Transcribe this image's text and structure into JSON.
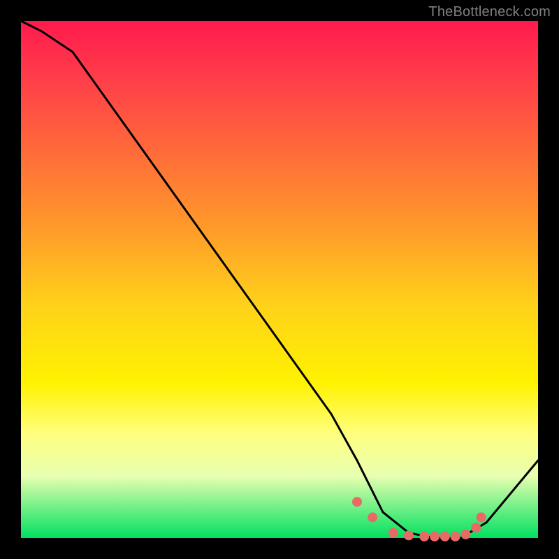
{
  "watermark": "TheBottleneck.com",
  "chart_data": {
    "type": "line",
    "title": "",
    "xlabel": "",
    "ylabel": "",
    "xlim": [
      0,
      100
    ],
    "ylim": [
      0,
      100
    ],
    "grid": false,
    "legend": false,
    "background_gradient": [
      "#ff1a4d",
      "#ffd21a",
      "#fff200",
      "#00e060"
    ],
    "series": [
      {
        "name": "bottleneck-curve",
        "color": "#000000",
        "x": [
          0,
          4,
          10,
          20,
          30,
          40,
          50,
          60,
          65,
          70,
          75,
          80,
          85,
          90,
          100
        ],
        "y": [
          100,
          98,
          94,
          80,
          66,
          52,
          38,
          24,
          15,
          5,
          1,
          0,
          0,
          3,
          15
        ]
      }
    ],
    "markers": [
      {
        "name": "highlight-dots",
        "color": "#e86a66",
        "radius_px": 7,
        "x": [
          65,
          68,
          72,
          75,
          78,
          80,
          82,
          84,
          86,
          88,
          89
        ],
        "y": [
          7,
          4,
          1,
          0.5,
          0.3,
          0.3,
          0.3,
          0.3,
          0.7,
          2,
          4
        ]
      }
    ]
  }
}
